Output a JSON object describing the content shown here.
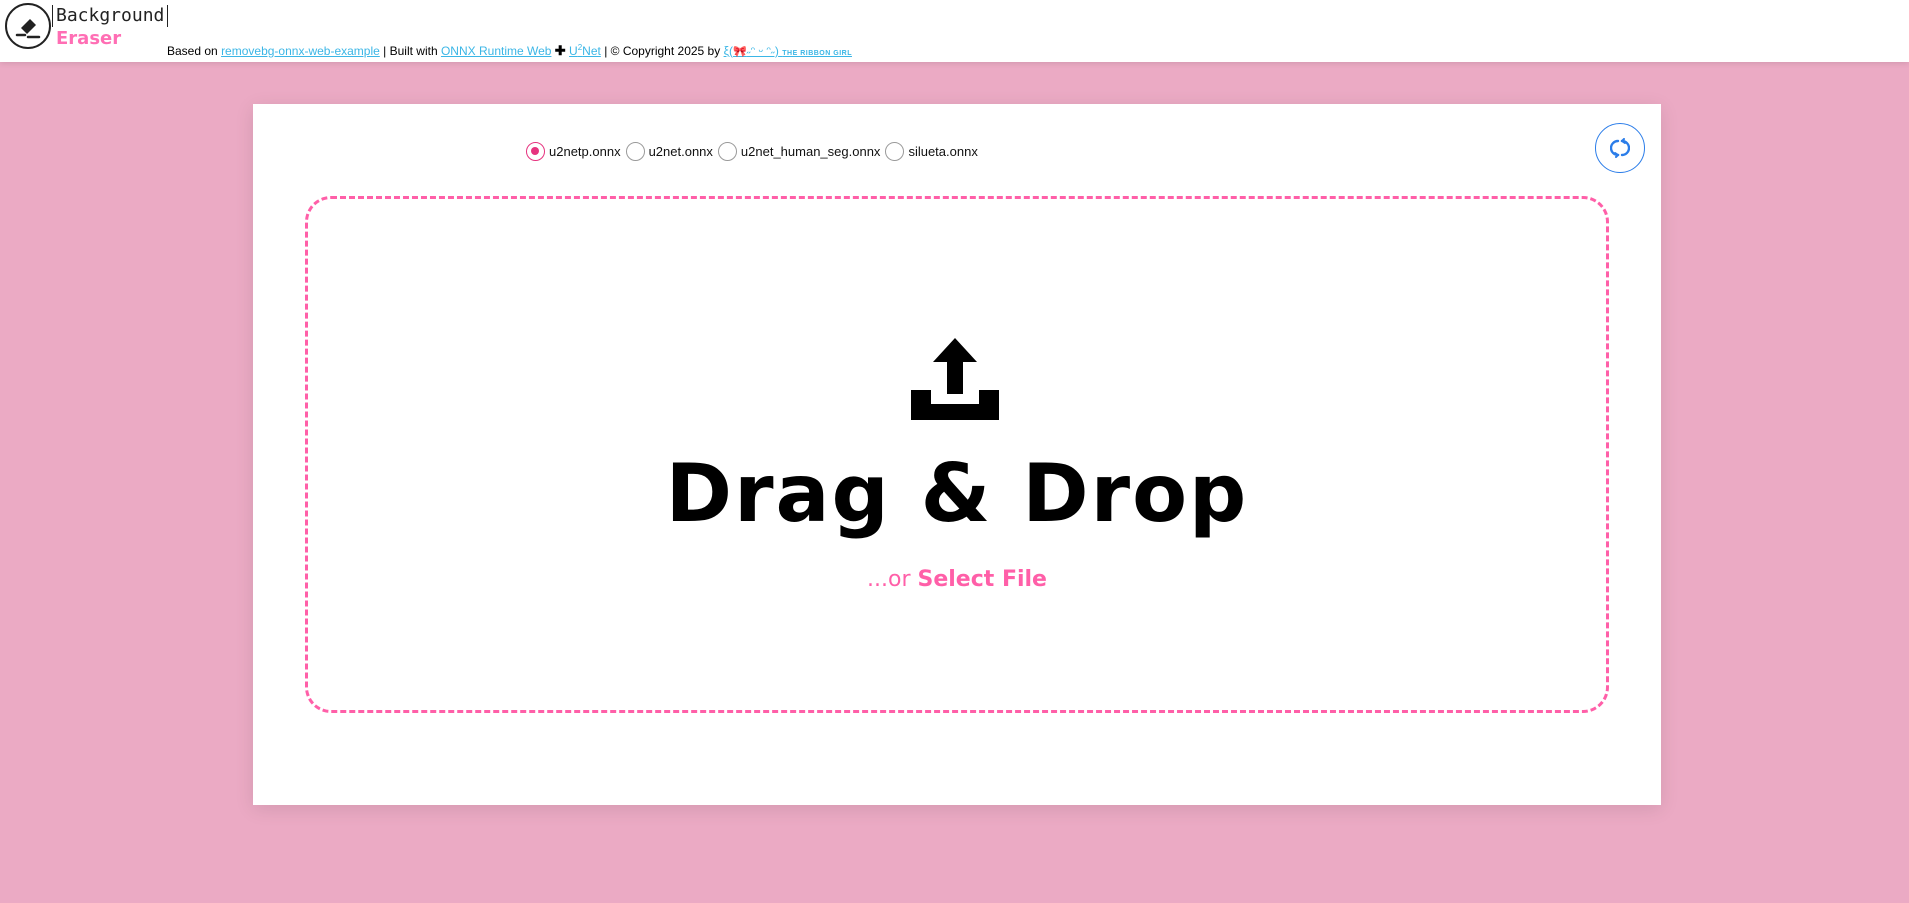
{
  "header": {
    "logo_top": "Background",
    "logo_bottom": "Eraser",
    "credits": {
      "based_on": "Based on",
      "link1": "removebg-onnx-web-example",
      "built_with": "| Built with",
      "link2": "ONNX Runtime Web",
      "plus": "✚",
      "link3_main": "U",
      "link3_sup": "2",
      "link3_rest": "Net",
      "copyright": "| © Copyright 2025 by",
      "ribbon_prefix": "ξ(",
      "ribbon_bow": "🎀",
      "ribbon_face": "˶ᵔ ᵕ ᵔ˶)",
      "ribbon_name": "THE RIBBON GIRL"
    }
  },
  "models": [
    {
      "label": "u2netp.onnx",
      "checked": true
    },
    {
      "label": "u2net.onnx",
      "checked": false
    },
    {
      "label": "u2net_human_seg.onnx",
      "checked": false
    },
    {
      "label": "silueta.onnx",
      "checked": false
    }
  ],
  "dropzone": {
    "title": "Drag & Drop",
    "or_text": "...or ",
    "select_label": "Select File"
  },
  "colors": {
    "background": "#ebaac4",
    "accent": "#ff5fa8",
    "radio_checked": "#e6337f",
    "link": "#3bb6e6",
    "sync": "#2b7de9"
  },
  "icons": [
    "logo-eraser-icon",
    "sync-icon",
    "upload-tray-icon"
  ]
}
